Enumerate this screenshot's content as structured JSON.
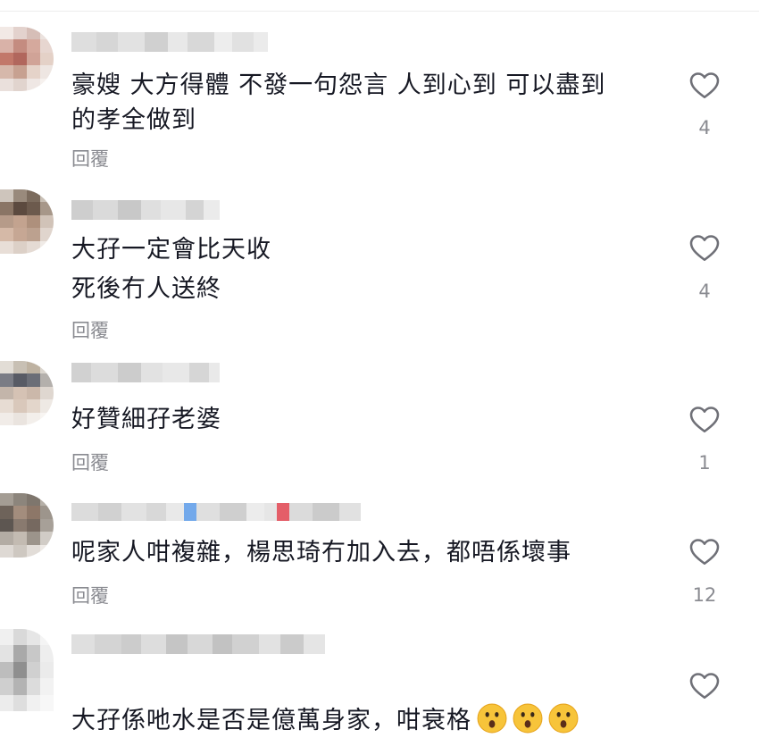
{
  "reply_label": "回覆",
  "like_icon": "heart-outline-icon",
  "colors": {
    "text": "#161823",
    "secondary": "#8a8b91",
    "icon": "#6f7077"
  },
  "comments": [
    {
      "text": "豪嫂 大方得體 不發一句怨言 人到心到 可以盡到\n的孝全做到",
      "likes": "4"
    },
    {
      "text": "大孖一定會比天收\n死後冇人送終",
      "likes": "4"
    },
    {
      "text": "好贊細孖老婆",
      "likes": "1"
    },
    {
      "text": "呢家人咁複雜，楊思琦冇加入去，都唔係壞事",
      "likes": "12"
    },
    {
      "text": "大孖係吔水是否是億萬身家，咁衰格",
      "emoji": [
        "astonished-face-emoji",
        "astonished-face-emoji",
        "astonished-face-emoji"
      ],
      "likes": ""
    }
  ]
}
